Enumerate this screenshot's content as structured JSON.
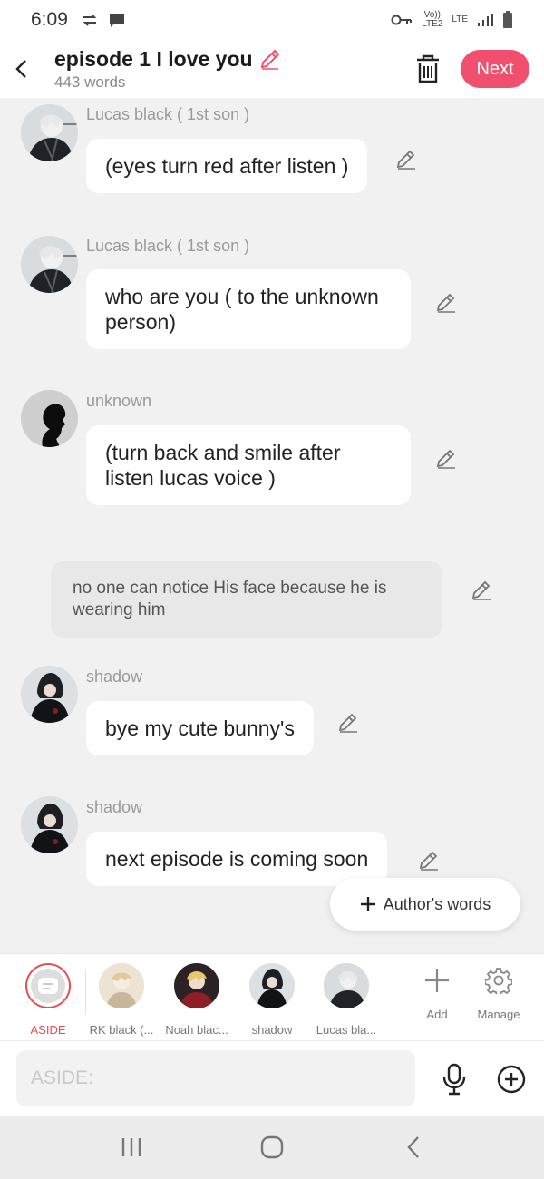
{
  "status_bar": {
    "time": "6:09",
    "volte_label": "Vo))",
    "lte_label": "LTE",
    "lte2_label": "LTE2"
  },
  "header": {
    "title": "episode 1 I love you",
    "word_count": "443 words",
    "next_label": "Next"
  },
  "messages": [
    {
      "name": "Lucas  black ( 1st  son )",
      "text": "(eyes turn red after listen )",
      "avatar": "lucas"
    },
    {
      "name": "Lucas  black ( 1st  son )",
      "text": "who are you ( to the  unknown person)",
      "avatar": "lucas"
    },
    {
      "name": "unknown",
      "text": "(turn back and smile after listen lucas voice )",
      "avatar": "unknown"
    },
    {
      "aside": "no one can notice His face because he is wearing him"
    },
    {
      "name": "shadow",
      "text": "bye my cute bunny's",
      "avatar": "shadow"
    },
    {
      "name": "shadow",
      "text": "next episode is coming soon",
      "avatar": "shadow"
    }
  ],
  "authors_words_label": "Author's words",
  "characters": [
    {
      "label": "ASIDE"
    },
    {
      "label": "RK black (..."
    },
    {
      "label": "Noah blac..."
    },
    {
      "label": "shadow"
    },
    {
      "label": "Lucas  bla..."
    }
  ],
  "tools": {
    "add_label": "Add",
    "manage_label": "Manage"
  },
  "input": {
    "placeholder": "ASIDE:"
  },
  "colors": {
    "accent": "#f0506e",
    "aside_red": "#e25050"
  }
}
